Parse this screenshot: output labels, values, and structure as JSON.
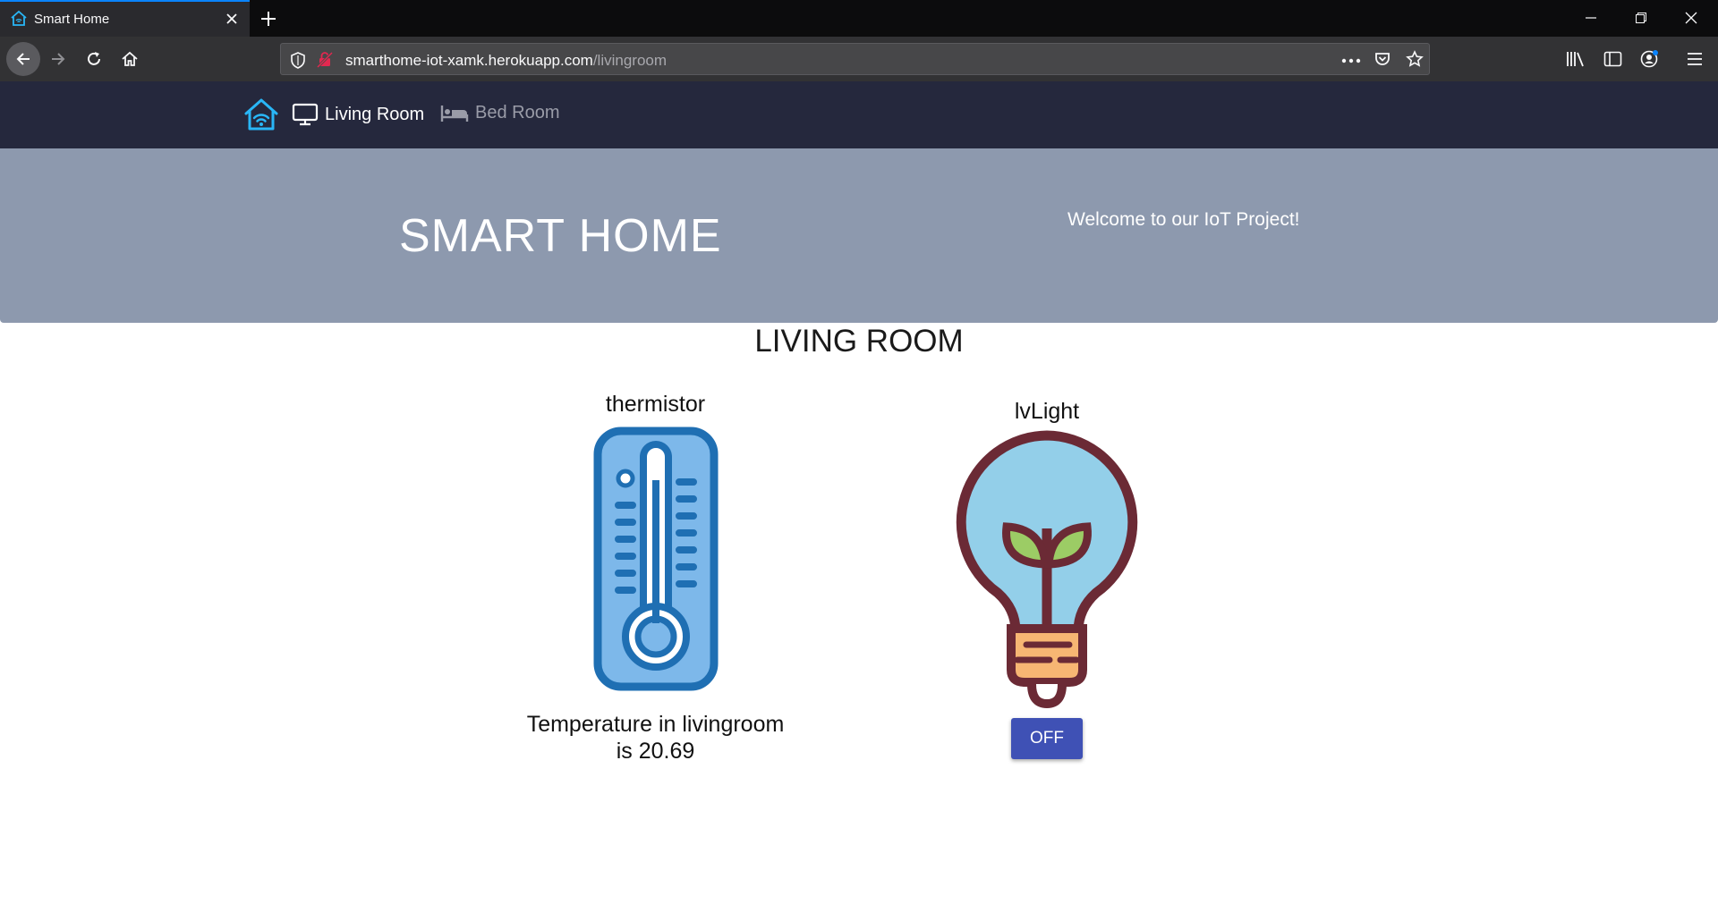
{
  "browser": {
    "tab_title": "Smart Home",
    "url_domain": "smarthome-iot-xamk.herokuapp.com",
    "url_path": "/livingroom"
  },
  "nav": {
    "brand_icon": "smart-home-wifi-icon",
    "links": [
      {
        "label": "Living Room",
        "icon": "monitor-icon",
        "active": true
      },
      {
        "label": "Bed Room",
        "icon": "bed-icon",
        "active": false
      }
    ]
  },
  "hero": {
    "title": "SMART HOME",
    "subtitle": "Welcome to our IoT Project!"
  },
  "room": {
    "title": "LIVING ROOM",
    "devices": [
      {
        "name": "thermistor",
        "icon": "thermometer-icon",
        "line1": "Temperature in livingroom",
        "line2": "is 20.69"
      },
      {
        "name": "lvLight",
        "icon": "lightbulb-icon",
        "button_label": "OFF"
      }
    ]
  },
  "colors": {
    "nav_bg": "#25283d",
    "hero_bg": "#8d99ae",
    "button": "#3f51b5",
    "brand_icon": "#29b6f6"
  }
}
